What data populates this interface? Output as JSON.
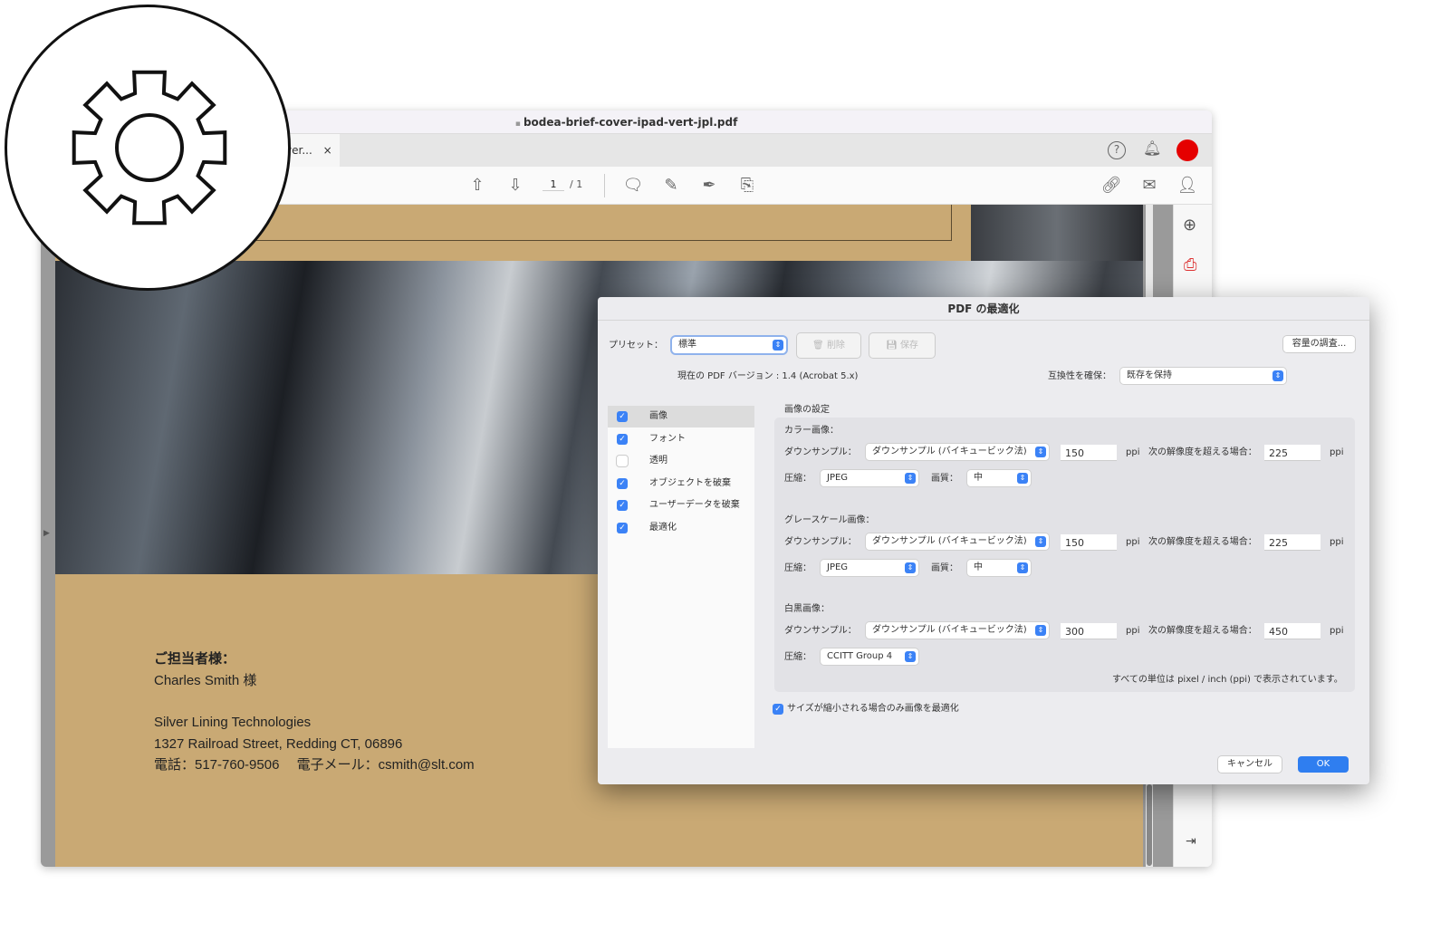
{
  "window": {
    "title": "bodea-brief-cover-ipad-vert-jpl.pdf",
    "tab_label": "ver...",
    "tab_close": "×",
    "page_current": "1",
    "page_total": "/ 1"
  },
  "toolbar_icons": [
    "arrow-up-icon",
    "arrow-down-icon",
    "comment-icon",
    "highlight-icon",
    "sign-icon",
    "edit-icon",
    "share-link-icon",
    "email-icon",
    "add-user-icon"
  ],
  "document": {
    "contact_label": "ご担当者様：",
    "contact_name": "Charles Smith 様",
    "company": "Silver Lining Technologies",
    "address": "1327 Railroad Street, Redding CT, 06896",
    "phone_email": "電話：517-760-9506　 電子メール：csmith@slt.com"
  },
  "dialog": {
    "title": "PDF の最適化",
    "preset_label": "プリセット：",
    "preset_value": "標準",
    "delete_label": "削除",
    "save_label": "保存",
    "audit_label": "容量の調査...",
    "pdf_version": "現在の PDF バージョン : 1.4 (Acrobat 5.x)",
    "compat_label": "互換性を確保：",
    "compat_value": "既存を保持",
    "panels": [
      {
        "label": "画像",
        "checked": true
      },
      {
        "label": "フォント",
        "checked": true
      },
      {
        "label": "透明",
        "checked": false
      },
      {
        "label": "オブジェクトを破棄",
        "checked": true
      },
      {
        "label": "ユーザーデータを破棄",
        "checked": true
      },
      {
        "label": "最適化",
        "checked": true
      }
    ],
    "section_title": "画像の設定",
    "downsample_label": "ダウンサンプル：",
    "compress_label": "圧縮：",
    "quality_label": "画質：",
    "ppi": "ppi",
    "above_label": "次の解像度を超える場合：",
    "color": {
      "title": "カラー画像：",
      "method": "ダウンサンプル (バイキュービック法)",
      "ppi": "150",
      "above": "225",
      "compression": "JPEG",
      "quality": "中"
    },
    "gray": {
      "title": "グレースケール画像：",
      "method": "ダウンサンプル (バイキュービック法)",
      "ppi": "150",
      "above": "225",
      "compression": "JPEG",
      "quality": "中"
    },
    "mono": {
      "title": "白黒画像：",
      "method": "ダウンサンプル (バイキュービック法)",
      "ppi": "300",
      "above": "450",
      "compression": "CCITT Group 4"
    },
    "units_note": "すべての単位は pixel / inch (ppi) で表示されています。",
    "only_if_smaller": "サイズが縮小される場合のみ画像を最適化",
    "cancel": "キャンセル",
    "ok": "OK"
  },
  "colors": {
    "accent": "#3b82f6",
    "tan": "#c9a974",
    "record": "#e50000"
  }
}
